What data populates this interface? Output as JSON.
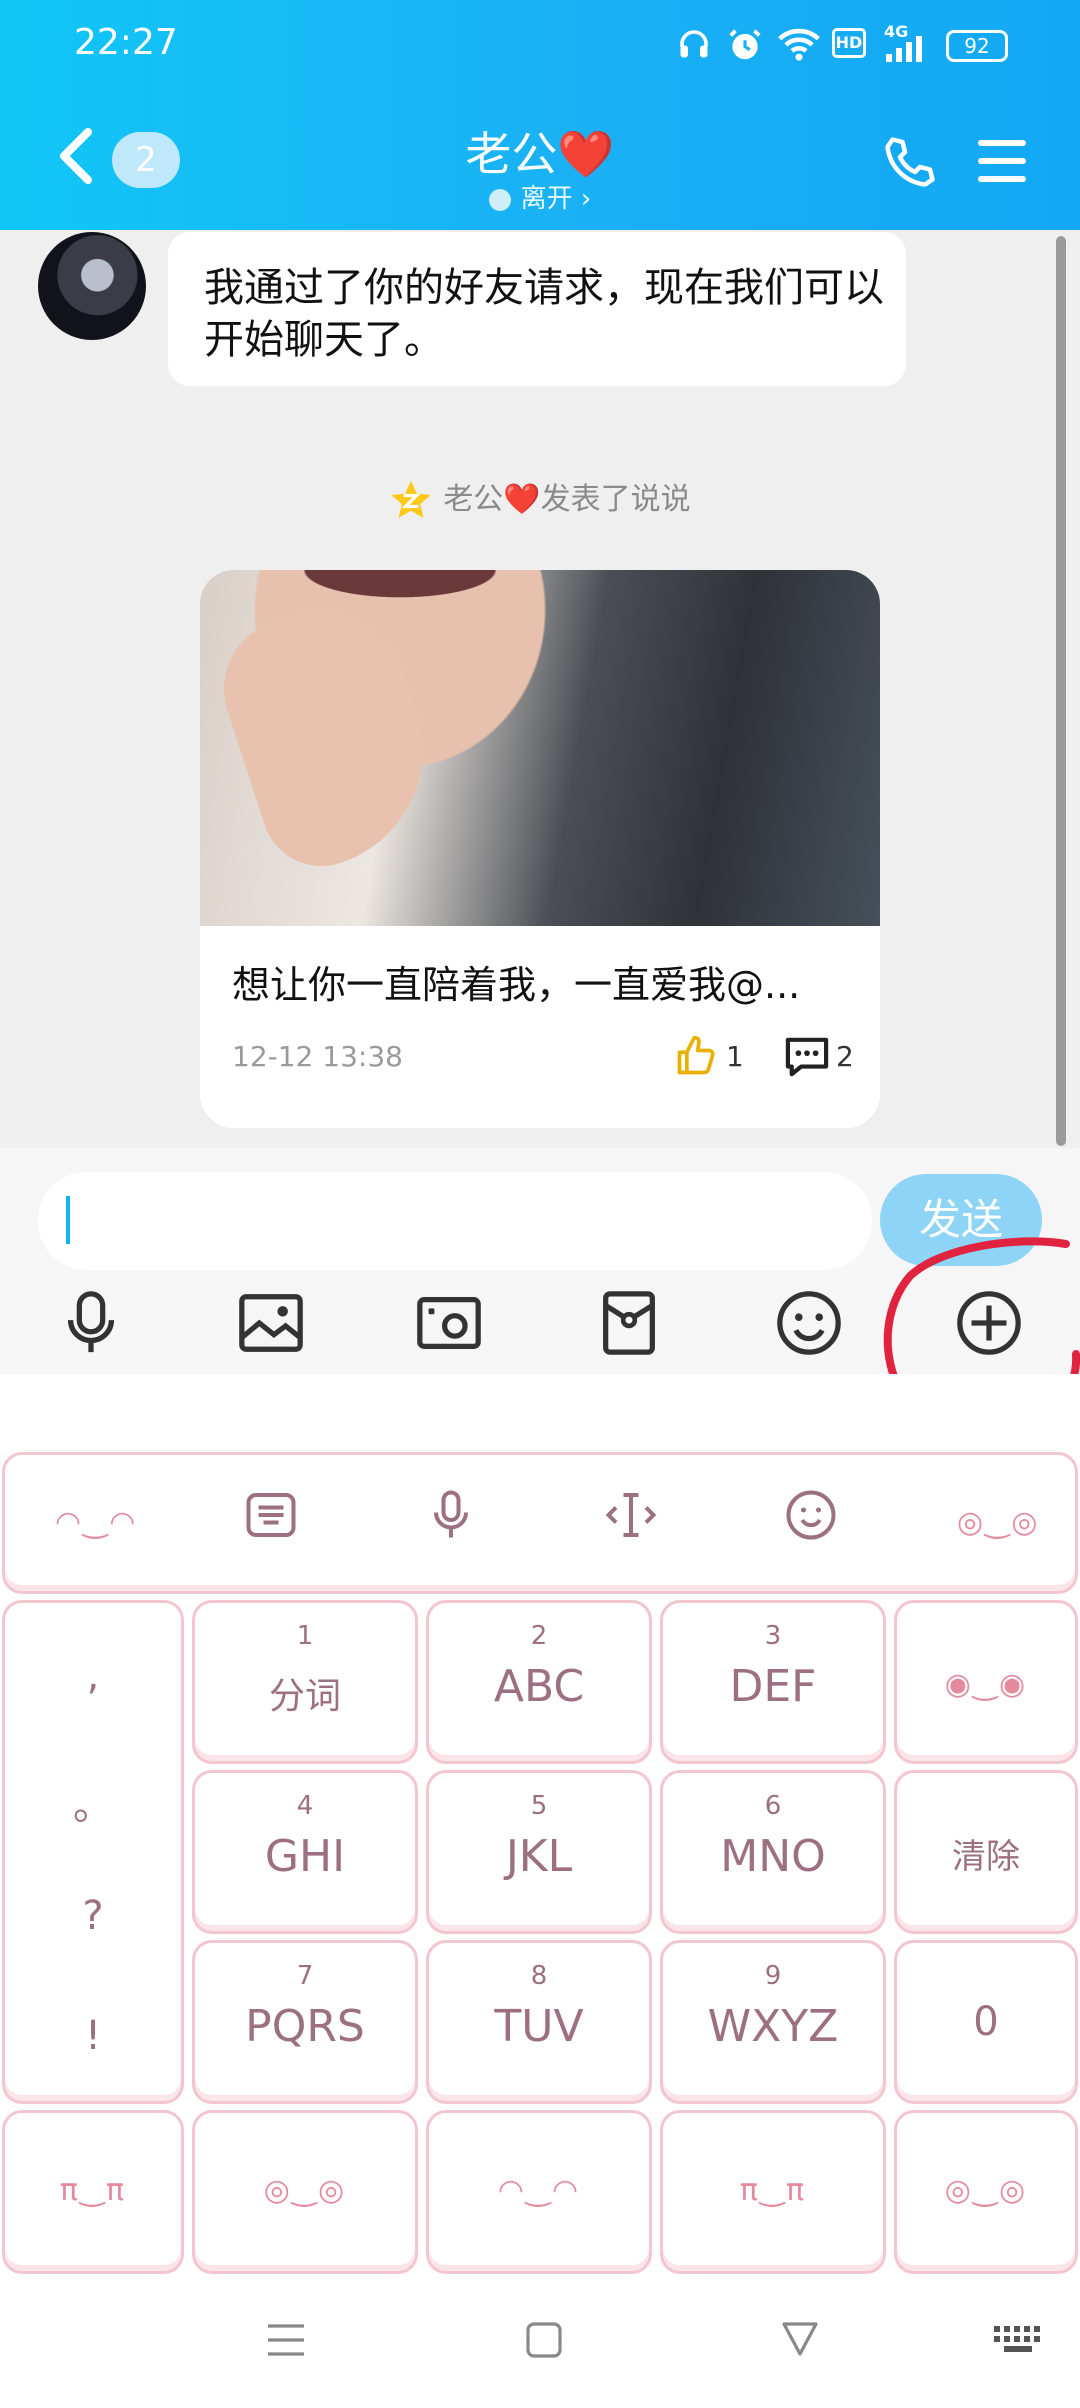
{
  "status_bar": {
    "time": "22:27",
    "battery": "92",
    "network": "4G",
    "hd": "HD"
  },
  "header": {
    "back_count": "2",
    "title": "老公❤️",
    "subtitle": "离开 ›"
  },
  "messages": [
    {
      "text": "我通过了你的好友请求，现在我们可以开始聊天了。"
    }
  ],
  "system_notice": "老公❤️发表了说说",
  "post_card": {
    "caption": "想让你一直陪着我，一直爱我@...",
    "time": "12-12 13:38",
    "likes": "1",
    "comments": "2"
  },
  "input": {
    "value": "",
    "placeholder": ""
  },
  "send_label": "发送",
  "toolbar_icons": [
    "microphone-icon",
    "image-icon",
    "camera-icon",
    "red-packet-icon",
    "emoji-icon",
    "plus-icon"
  ],
  "keyboard": {
    "top_row_faces": [
      "◠‿◠",
      "◎‿◎"
    ],
    "punct": [
      ",",
      "。",
      "?",
      "!"
    ],
    "keys": [
      {
        "num": "1",
        "label": "分词"
      },
      {
        "num": "2",
        "label": "ABC"
      },
      {
        "num": "3",
        "label": "DEF"
      },
      {
        "num": "4",
        "label": "GHI"
      },
      {
        "num": "5",
        "label": "JKL"
      },
      {
        "num": "6",
        "label": "MNO"
      },
      {
        "num": "7",
        "label": "PQRS"
      },
      {
        "num": "8",
        "label": "TUV"
      },
      {
        "num": "9",
        "label": "WXYZ"
      }
    ],
    "side_keys": {
      "face": "◉‿◉",
      "clear": "清除",
      "zero": "0"
    },
    "bottom_faces": [
      "π‿π",
      "◎‿◎",
      "◠‿◠",
      "π‿π",
      "◎‿◎"
    ]
  },
  "colors": {
    "header_accent": "#12a8f4",
    "send_button": "#8ed4f7",
    "key_border": "#f3c5cf",
    "annotation_circle": "#e0243f"
  }
}
